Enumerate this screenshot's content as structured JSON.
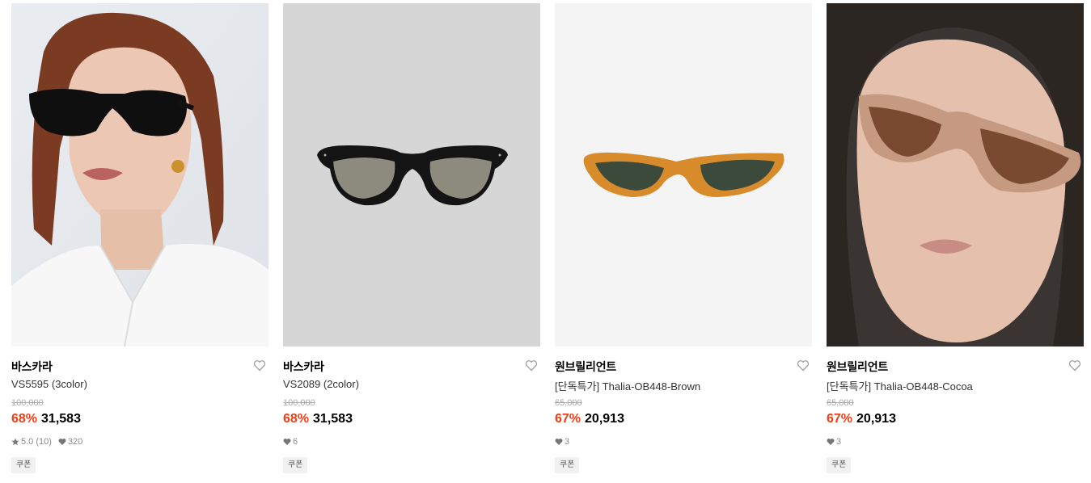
{
  "products": [
    {
      "brand": "바스카라",
      "name": "VS5595 (3color)",
      "original_price": "100,000",
      "discount": "68%",
      "price": "31,583",
      "rating": "5.0 (10)",
      "likes": "320",
      "coupon": "쿠폰",
      "image_icon": "model-black-sunglasses-image"
    },
    {
      "brand": "바스카라",
      "name": "VS2089 (2color)",
      "original_price": "100,000",
      "discount": "68%",
      "price": "31,583",
      "likes": "6",
      "coupon": "쿠폰",
      "image_icon": "black-round-sunglasses-image"
    },
    {
      "brand": "원브릴리언트",
      "name": "[단독특가] Thalia-OB448-Brown",
      "original_price": "65,000",
      "discount": "67%",
      "price": "20,913",
      "likes": "3",
      "coupon": "쿠폰",
      "image_icon": "orange-cateye-sunglasses-image"
    },
    {
      "brand": "원브릴리언트",
      "name": "[단독특가] Thalia-OB448-Cocoa",
      "original_price": "65,000",
      "discount": "67%",
      "price": "20,913",
      "likes": "3",
      "coupon": "쿠폰",
      "image_icon": "model-cocoa-sunglasses-image"
    }
  ],
  "colors": {
    "discount": "#ee3d16",
    "meta_text": "#8a8a8a",
    "coupon_bg": "#f1f1f1"
  }
}
